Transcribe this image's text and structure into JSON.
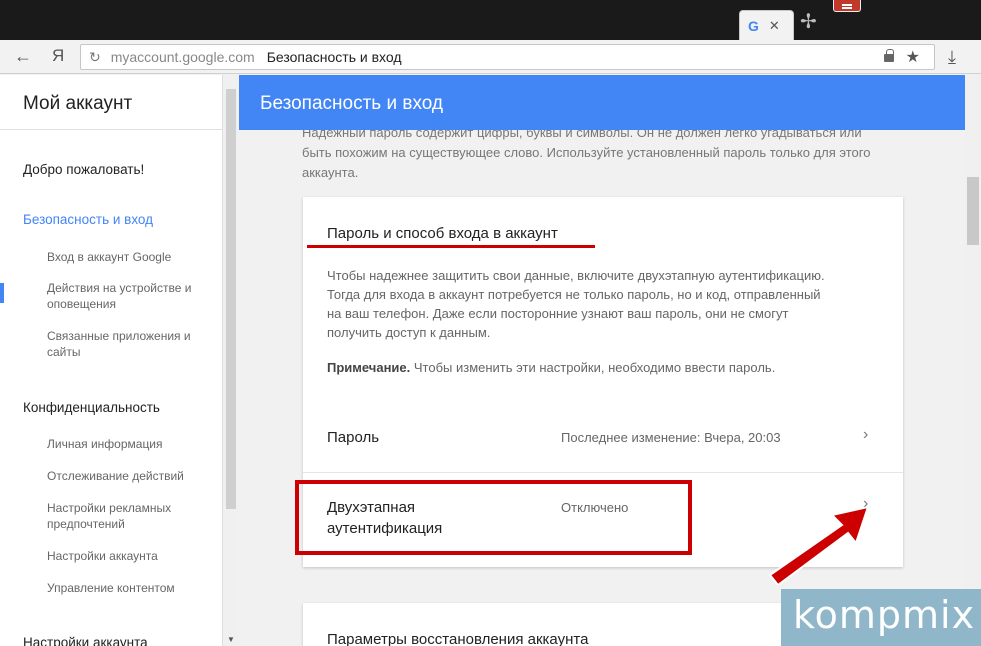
{
  "browser": {
    "domain": "myaccount.google.com",
    "page_title": "Безопасность и вход",
    "back_glyph": "←",
    "yandex_glyph": "Я",
    "reload_glyph": "↻",
    "star_glyph": "★",
    "download_glyph": "⤓",
    "tab_close_glyph": "✕",
    "new_tab_glyph": "✢",
    "tab_favicon": "G"
  },
  "sidebar": {
    "title": "Мой аккаунт",
    "welcome": "Добро пожаловать!",
    "security": "Безопасность и вход",
    "security_items": [
      "Вход в аккаунт Google",
      "Действия на устройстве и оповещения",
      "Связанные приложения и сайты"
    ],
    "privacy": "Конфиденциальность",
    "privacy_items": [
      "Личная информация",
      "Отслеживание действий",
      "Настройки рекламных предпочтений",
      "Настройки аккаунта",
      "Управление контентом"
    ],
    "account_settings": "Настройки аккаунта"
  },
  "main": {
    "header": "Безопасность и вход",
    "intro": "Надежный пароль содержит цифры, буквы и символы. Он не должен легко угадываться или быть похожим на существующее слово. Используйте установленный пароль только для этого аккаунта.",
    "card": {
      "title": "Пароль и способ входа в аккаунт",
      "description": "Чтобы надежнее защитить свои данные, включите двухэтапную аутентификацию. Тогда для входа в аккаунт потребуется не только пароль, но и код, отправленный на ваш телефон. Даже если посторонние узнают ваш пароль, они не смогут получить доступ к данным.",
      "note_label": "Примечание.",
      "note_text": " Чтобы изменить эти настройки, необходимо ввести пароль.",
      "password_label": "Пароль",
      "password_value": "Последнее изменение: Вчера, 20:03",
      "twofa_label_1": "Двухэтапная",
      "twofa_label_2": "аутентификация",
      "twofa_value": "Отключено",
      "chevron": "›"
    },
    "card2_title": "Параметры восстановления аккаунта"
  },
  "watermark": "kompmix",
  "colors": {
    "accent": "#4285f4",
    "highlight": "#cc0000",
    "watermark_bg": "#8fb7c9"
  }
}
